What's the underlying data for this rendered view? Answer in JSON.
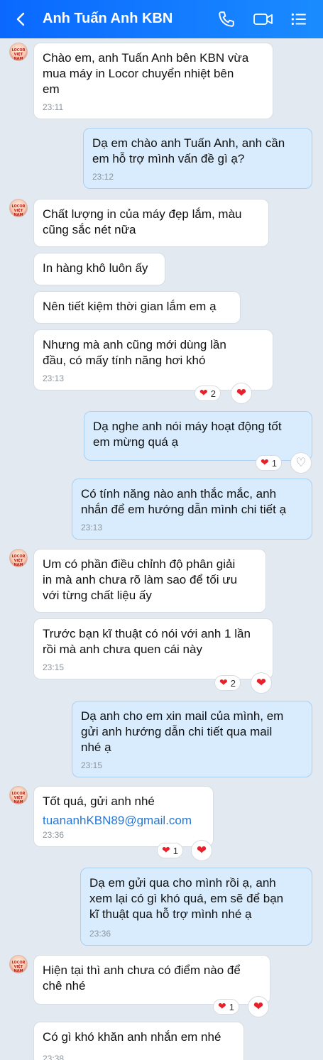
{
  "header": {
    "contact_name": "Anh Tuấn Anh KBN",
    "icons": [
      "back-chevron-icon",
      "phone-icon",
      "video-call-icon",
      "menu-list-icon"
    ]
  },
  "avatar": {
    "text": "LOCOR\nVIỆT NAM"
  },
  "messages": [
    {
      "text": "Chào em, anh Tuấn Anh bên KBN vừa\nmua máy in Locor chuyển nhiệt bên\nem",
      "time": "23:11"
    },
    {
      "text": "Dạ em chào anh Tuấn Anh, anh cần\nem hỗ trợ mình vấn đề gì ạ?",
      "time": "23:12"
    },
    {
      "text": "Chất lượng in của máy đẹp lắm, màu\ncũng sắc nét nữa"
    },
    {
      "text": "In hàng khô luôn ấy"
    },
    {
      "text": "Nên tiết kiệm thời gian lắm em ạ"
    },
    {
      "text": "Nhưng mà anh cũng mới dùng lần\nđầu, có mấy tính năng hơi khó",
      "time": "23:13",
      "reaction_count": "2"
    },
    {
      "text": "Dạ nghe anh nói máy hoạt động tốt\nem mừng quá ạ",
      "reaction_count": "1"
    },
    {
      "text": "Có tính năng nào anh thắc mắc, anh\nnhắn để em hướng dẫn mình chi tiết ạ",
      "time": "23:13"
    },
    {
      "text": "Um có phần điều chỉnh độ phân giải\nin mà anh chưa rõ làm sao để tối ưu\nvới từng chất liệu ấy"
    },
    {
      "text": "Trước bạn kĩ thuật có nói với anh 1 lần\nrồi mà anh chưa quen cái này",
      "time": "23:15",
      "reaction_count": "2"
    },
    {
      "text": "Dạ anh cho em xin mail của mình, em\ngửi anh hướng dẫn chi tiết qua mail\nnhé ạ",
      "time": "23:15"
    },
    {
      "text": "Tốt quá, gửi anh nhé",
      "email": "tuananhKBN89@gmail.com",
      "time": "23:36",
      "reaction_count": "1"
    },
    {
      "text": "Dạ em gửi qua cho mình rồi ạ, anh\nxem lại có gì khó quá, em sẽ để bạn\nkĩ thuật qua hỗ trợ mình nhé ạ",
      "time": "23:36"
    },
    {
      "text": "Hiện tại thì anh chưa có điểm nào để\nchê nhé",
      "reaction_count": "1"
    },
    {
      "text": "Có gì khó khăn anh nhắn em nhé",
      "time": "23:38"
    }
  ],
  "reaction_glyph": "❤",
  "reaction_empty_glyph": "♡"
}
